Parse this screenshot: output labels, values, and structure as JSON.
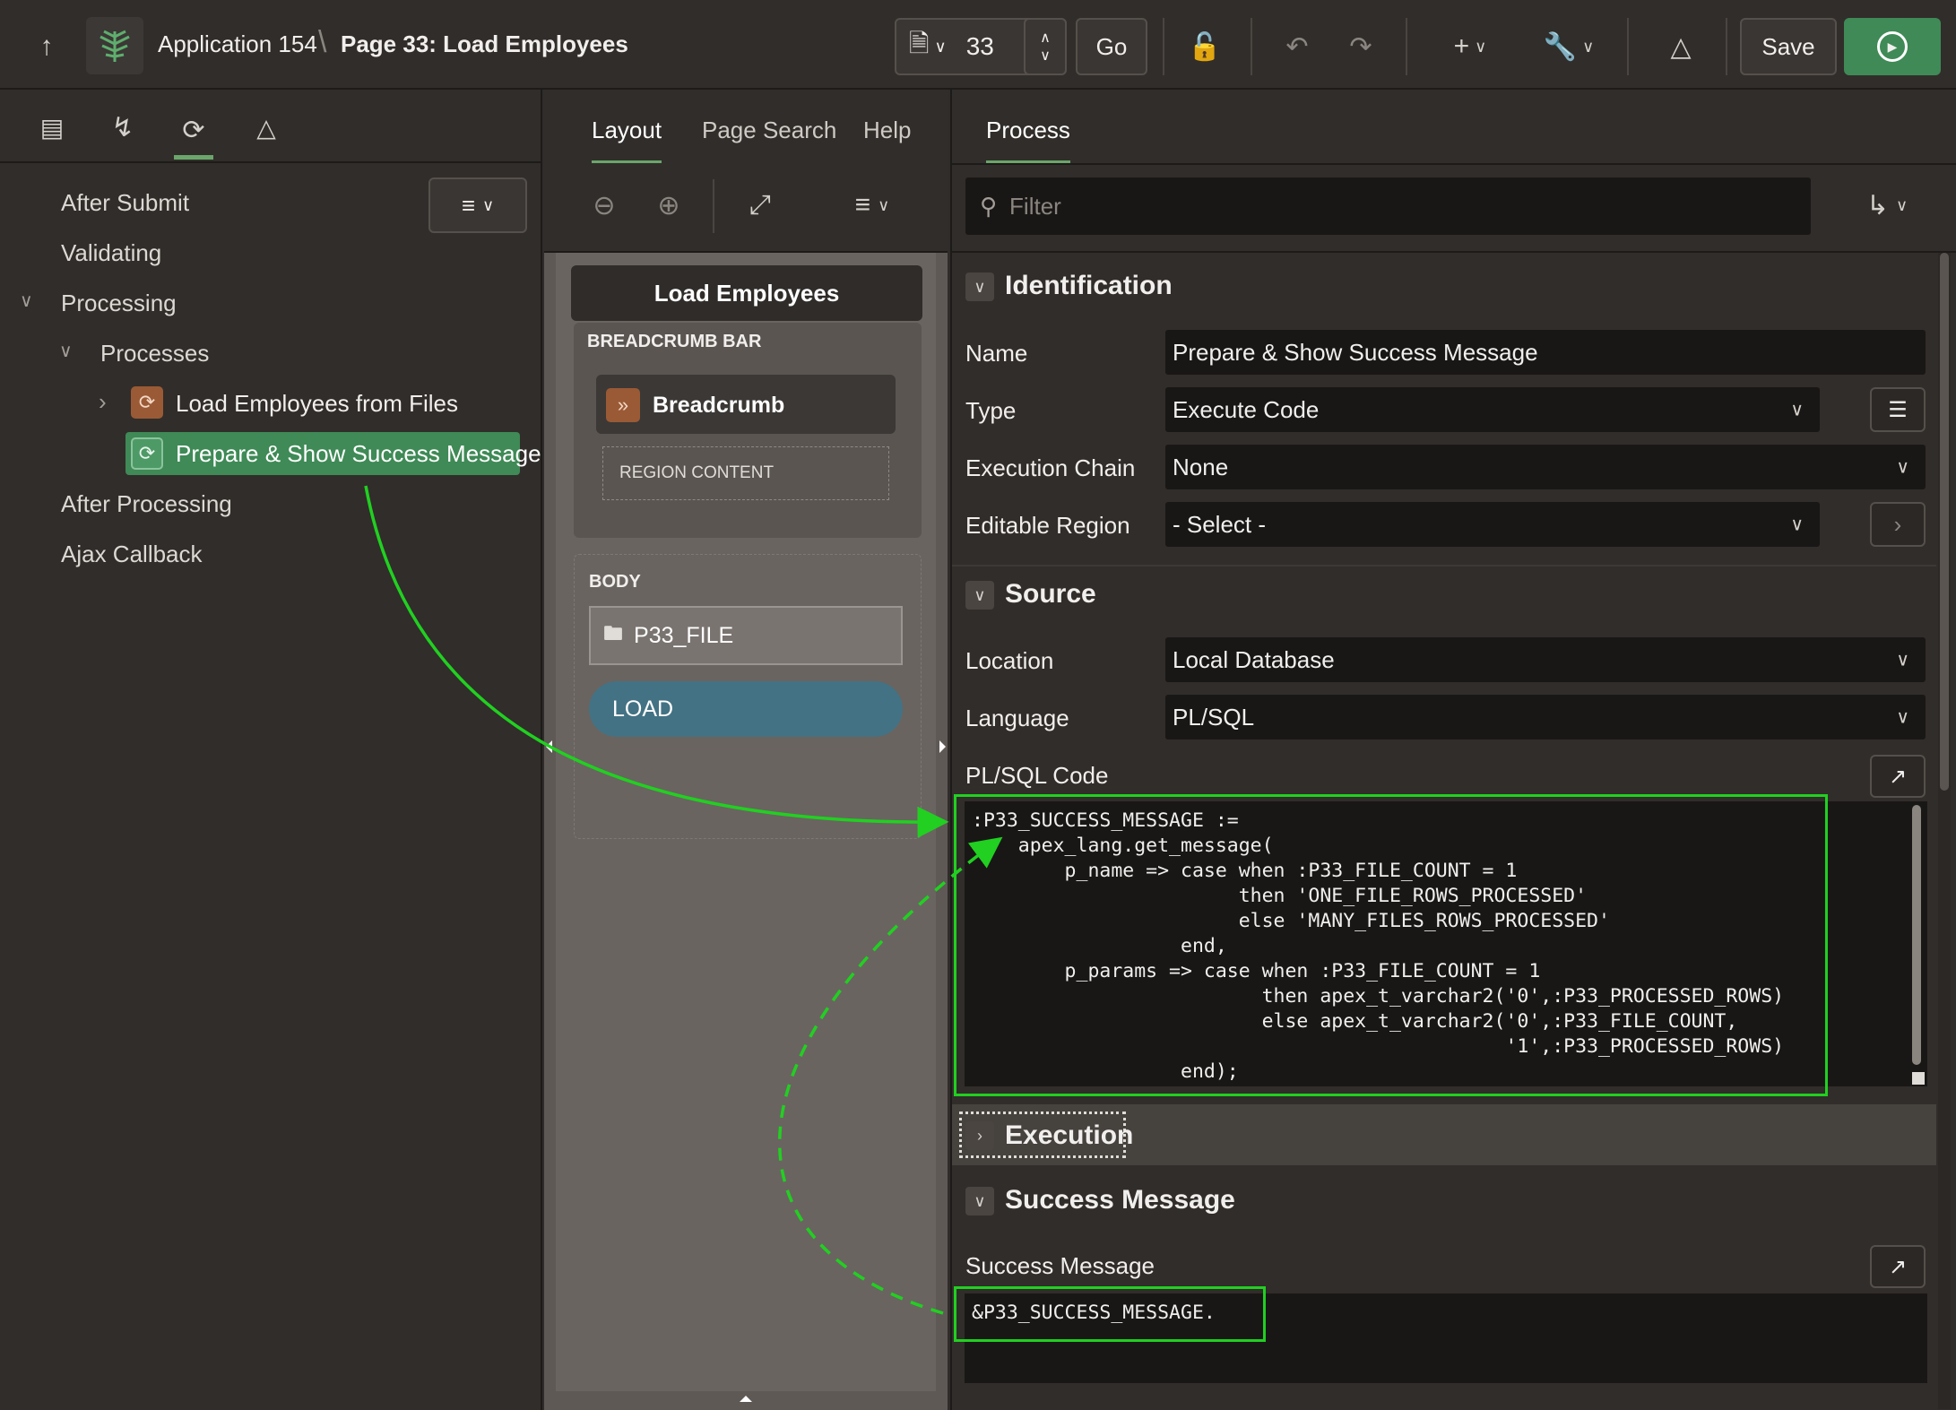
{
  "header": {
    "app_name": "Application 154",
    "separator": "\\",
    "page_title": "Page 33: Load Employees",
    "page_number": "33",
    "go_label": "Go",
    "save_label": "Save"
  },
  "left_panel": {
    "tree": {
      "after_submit": "After Submit",
      "validating": "Validating",
      "processing": "Processing",
      "processes": "Processes",
      "process_1": "Load Employees from Files",
      "process_2": "Prepare & Show Success Message",
      "after_processing": "After Processing",
      "ajax_callback": "Ajax Callback"
    }
  },
  "middle_panel": {
    "tabs": [
      "Layout",
      "Page Search",
      "Help"
    ],
    "page_region_title": "Load Employees",
    "breadcrumb_bar_label": "BREADCRUMB BAR",
    "breadcrumb_label": "Breadcrumb",
    "region_content_label": "REGION CONTENT",
    "body_label": "BODY",
    "file_item": "P33_FILE",
    "load_button": "LOAD"
  },
  "right_panel": {
    "tab": "Process",
    "filter_placeholder": "Filter",
    "identification": {
      "title": "Identification",
      "name_label": "Name",
      "name_value": "Prepare & Show Success Message",
      "type_label": "Type",
      "type_value": "Execute Code",
      "chain_label": "Execution Chain",
      "chain_value": "None",
      "editable_label": "Editable Region",
      "editable_value": "- Select -"
    },
    "source": {
      "title": "Source",
      "location_label": "Location",
      "location_value": "Local Database",
      "language_label": "Language",
      "language_value": "PL/SQL",
      "code_label": "PL/SQL Code",
      "code": ":P33_SUCCESS_MESSAGE :=\n    apex_lang.get_message(\n        p_name => case when :P33_FILE_COUNT = 1\n                       then 'ONE_FILE_ROWS_PROCESSED'\n                       else 'MANY_FILES_ROWS_PROCESSED'\n                  end,\n        p_params => case when :P33_FILE_COUNT = 1\n                         then apex_t_varchar2('0',:P33_PROCESSED_ROWS)\n                         else apex_t_varchar2('0',:P33_FILE_COUNT,\n                                              '1',:P33_PROCESSED_ROWS)\n                  end);"
    },
    "execution": {
      "title": "Execution"
    },
    "success": {
      "title": "Success Message",
      "label": "Success Message",
      "value": "&P33_SUCCESS_MESSAGE."
    }
  },
  "colors": {
    "accent_green": "#21d021",
    "selected_node": "#3f8a56",
    "run_button": "#3f8a56",
    "load_button": "#437284",
    "process_icon": "#9a5a36"
  }
}
